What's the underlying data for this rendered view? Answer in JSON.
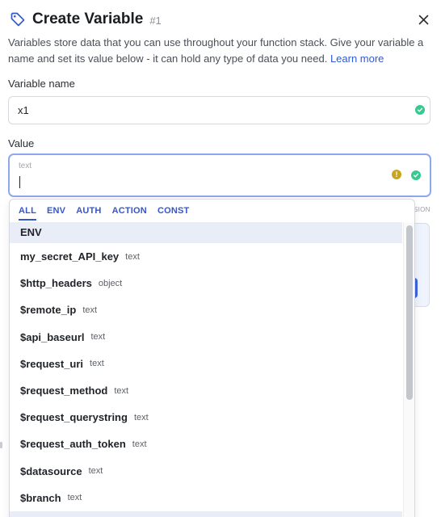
{
  "header": {
    "title": "Create Variable",
    "number": "#1",
    "icon": "tag-icon",
    "close_icon": "close-icon"
  },
  "description": {
    "text": "Variables store data that you can use throughout your function stack. Give your variable a name and set its value below - it can hold any type of data you need.",
    "link": "Learn more"
  },
  "variable_name": {
    "label": "Variable name",
    "value": "x1"
  },
  "value_field": {
    "label": "Value",
    "type_hint": "text"
  },
  "background": {
    "partial_text": "SION"
  },
  "dropdown": {
    "tabs": [
      {
        "label": "ALL"
      },
      {
        "label": "ENV"
      },
      {
        "label": "AUTH"
      },
      {
        "label": "ACTION"
      },
      {
        "label": "CONST"
      }
    ],
    "active_tab": "ALL",
    "section": "ENV",
    "items": [
      {
        "name": "my_secret_API_key",
        "type": "text"
      },
      {
        "name": "$http_headers",
        "type": "object"
      },
      {
        "name": "$remote_ip",
        "type": "text"
      },
      {
        "name": "$api_baseurl",
        "type": "text"
      },
      {
        "name": "$request_uri",
        "type": "text"
      },
      {
        "name": "$request_method",
        "type": "text"
      },
      {
        "name": "$request_querystring",
        "type": "text"
      },
      {
        "name": "$request_auth_token",
        "type": "text"
      },
      {
        "name": "$datasource",
        "type": "text"
      },
      {
        "name": "$branch",
        "type": "text"
      },
      {
        "name": "",
        "type": ""
      }
    ]
  },
  "colors": {
    "accent": "#3457c9",
    "focus_border": "#8ea8ee",
    "section_bg": "#e9edf8",
    "ok": "#37c98f",
    "warning": "#c7a520"
  }
}
